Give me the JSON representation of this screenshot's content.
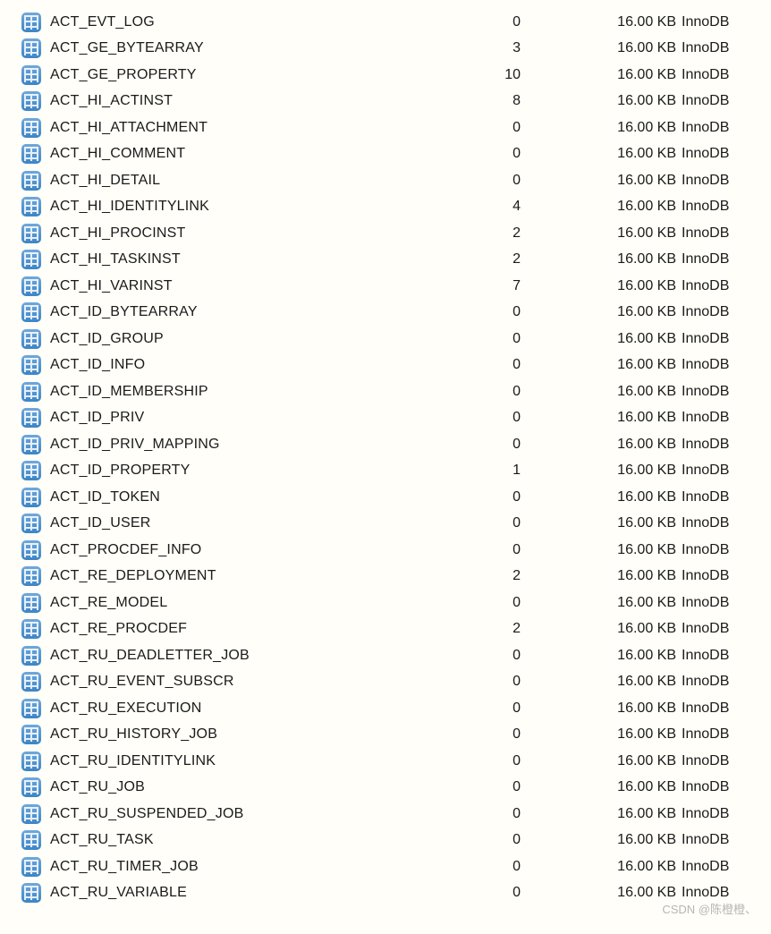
{
  "tables": [
    {
      "name": "ACT_EVT_LOG",
      "rows": "0",
      "size": "16.00 KB",
      "engine": "InnoDB"
    },
    {
      "name": "ACT_GE_BYTEARRAY",
      "rows": "3",
      "size": "16.00 KB",
      "engine": "InnoDB"
    },
    {
      "name": "ACT_GE_PROPERTY",
      "rows": "10",
      "size": "16.00 KB",
      "engine": "InnoDB"
    },
    {
      "name": "ACT_HI_ACTINST",
      "rows": "8",
      "size": "16.00 KB",
      "engine": "InnoDB"
    },
    {
      "name": "ACT_HI_ATTACHMENT",
      "rows": "0",
      "size": "16.00 KB",
      "engine": "InnoDB"
    },
    {
      "name": "ACT_HI_COMMENT",
      "rows": "0",
      "size": "16.00 KB",
      "engine": "InnoDB"
    },
    {
      "name": "ACT_HI_DETAIL",
      "rows": "0",
      "size": "16.00 KB",
      "engine": "InnoDB"
    },
    {
      "name": "ACT_HI_IDENTITYLINK",
      "rows": "4",
      "size": "16.00 KB",
      "engine": "InnoDB"
    },
    {
      "name": "ACT_HI_PROCINST",
      "rows": "2",
      "size": "16.00 KB",
      "engine": "InnoDB"
    },
    {
      "name": "ACT_HI_TASKINST",
      "rows": "2",
      "size": "16.00 KB",
      "engine": "InnoDB"
    },
    {
      "name": "ACT_HI_VARINST",
      "rows": "7",
      "size": "16.00 KB",
      "engine": "InnoDB"
    },
    {
      "name": "ACT_ID_BYTEARRAY",
      "rows": "0",
      "size": "16.00 KB",
      "engine": "InnoDB"
    },
    {
      "name": "ACT_ID_GROUP",
      "rows": "0",
      "size": "16.00 KB",
      "engine": "InnoDB"
    },
    {
      "name": "ACT_ID_INFO",
      "rows": "0",
      "size": "16.00 KB",
      "engine": "InnoDB"
    },
    {
      "name": "ACT_ID_MEMBERSHIP",
      "rows": "0",
      "size": "16.00 KB",
      "engine": "InnoDB"
    },
    {
      "name": "ACT_ID_PRIV",
      "rows": "0",
      "size": "16.00 KB",
      "engine": "InnoDB"
    },
    {
      "name": "ACT_ID_PRIV_MAPPING",
      "rows": "0",
      "size": "16.00 KB",
      "engine": "InnoDB"
    },
    {
      "name": "ACT_ID_PROPERTY",
      "rows": "1",
      "size": "16.00 KB",
      "engine": "InnoDB"
    },
    {
      "name": "ACT_ID_TOKEN",
      "rows": "0",
      "size": "16.00 KB",
      "engine": "InnoDB"
    },
    {
      "name": "ACT_ID_USER",
      "rows": "0",
      "size": "16.00 KB",
      "engine": "InnoDB"
    },
    {
      "name": "ACT_PROCDEF_INFO",
      "rows": "0",
      "size": "16.00 KB",
      "engine": "InnoDB"
    },
    {
      "name": "ACT_RE_DEPLOYMENT",
      "rows": "2",
      "size": "16.00 KB",
      "engine": "InnoDB"
    },
    {
      "name": "ACT_RE_MODEL",
      "rows": "0",
      "size": "16.00 KB",
      "engine": "InnoDB"
    },
    {
      "name": "ACT_RE_PROCDEF",
      "rows": "2",
      "size": "16.00 KB",
      "engine": "InnoDB"
    },
    {
      "name": "ACT_RU_DEADLETTER_JOB",
      "rows": "0",
      "size": "16.00 KB",
      "engine": "InnoDB"
    },
    {
      "name": "ACT_RU_EVENT_SUBSCR",
      "rows": "0",
      "size": "16.00 KB",
      "engine": "InnoDB"
    },
    {
      "name": "ACT_RU_EXECUTION",
      "rows": "0",
      "size": "16.00 KB",
      "engine": "InnoDB"
    },
    {
      "name": "ACT_RU_HISTORY_JOB",
      "rows": "0",
      "size": "16.00 KB",
      "engine": "InnoDB"
    },
    {
      "name": "ACT_RU_IDENTITYLINK",
      "rows": "0",
      "size": "16.00 KB",
      "engine": "InnoDB"
    },
    {
      "name": "ACT_RU_JOB",
      "rows": "0",
      "size": "16.00 KB",
      "engine": "InnoDB"
    },
    {
      "name": "ACT_RU_SUSPENDED_JOB",
      "rows": "0",
      "size": "16.00 KB",
      "engine": "InnoDB"
    },
    {
      "name": "ACT_RU_TASK",
      "rows": "0",
      "size": "16.00 KB",
      "engine": "InnoDB"
    },
    {
      "name": "ACT_RU_TIMER_JOB",
      "rows": "0",
      "size": "16.00 KB",
      "engine": "InnoDB"
    },
    {
      "name": "ACT_RU_VARIABLE",
      "rows": "0",
      "size": "16.00 KB",
      "engine": "InnoDB"
    }
  ],
  "watermark": "CSDN @陈橙橙、"
}
